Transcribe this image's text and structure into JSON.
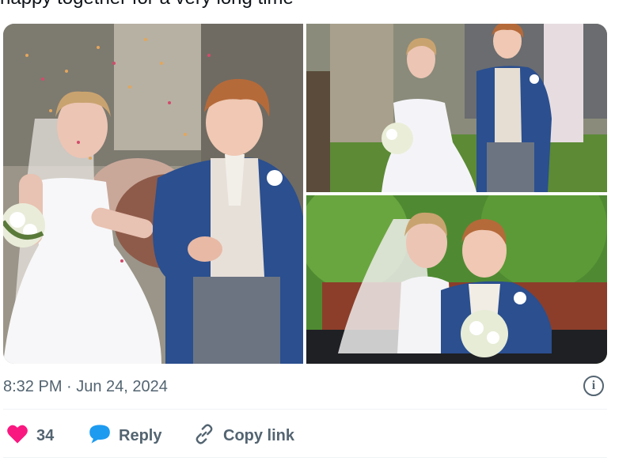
{
  "tweet": {
    "text_fragment": "happy together for a very long time",
    "emoji": "sparkles-trio"
  },
  "media": {
    "photos": [
      {
        "name": "wedding-photo-confetti"
      },
      {
        "name": "wedding-photo-walking"
      },
      {
        "name": "wedding-photo-carriage"
      }
    ]
  },
  "meta": {
    "timestamp": "8:32 PM · Jun 24, 2024",
    "info_icon": "info-icon"
  },
  "actions": {
    "like_count": "34",
    "like_icon": "heart-icon",
    "like_color": "#f91880",
    "reply_label": "Reply",
    "reply_icon": "speech-bubble-icon",
    "reply_color": "#1d9bf0",
    "copy_label": "Copy link",
    "copy_icon": "link-icon"
  }
}
